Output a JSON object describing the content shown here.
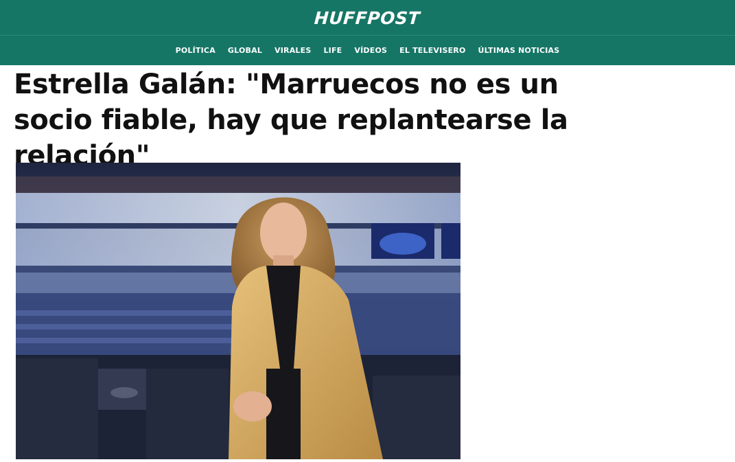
{
  "site": {
    "logo": "HUFFPOST"
  },
  "nav": {
    "items": [
      {
        "label": "POLÍTICA"
      },
      {
        "label": "GLOBAL"
      },
      {
        "label": "VIRALES"
      },
      {
        "label": "LIFE"
      },
      {
        "label": "VÍDEOS"
      },
      {
        "label": "EL TELEVISERO"
      },
      {
        "label": "ÚLTIMAS NOTICIAS"
      }
    ]
  },
  "article": {
    "headline": "Estrella Galán: \"Marruecos no es un socio fiable, hay que replantearse la relación\""
  },
  "colors": {
    "brand": "#167666",
    "headline_text": "#111111"
  }
}
